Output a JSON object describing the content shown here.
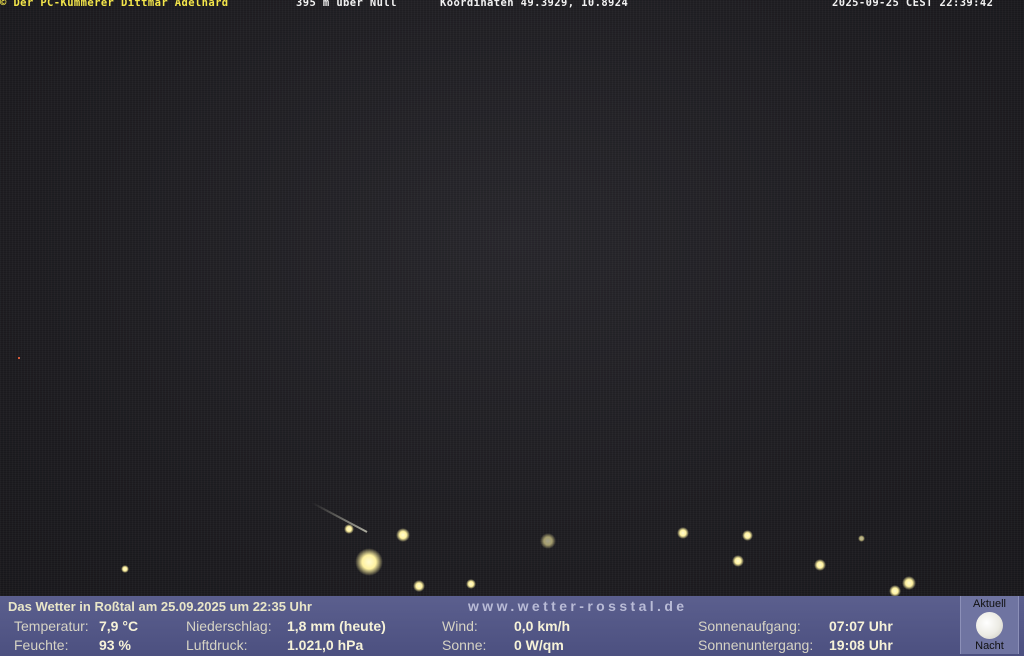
{
  "overlay": {
    "copyright": "© Der PC-Kümmerer Dittmar Adelhard",
    "altitude": "395 m über Null",
    "coordinates": "Koordinaten 49.3929, 10.8924",
    "timestamp": "2025-09-25 CEST 22:39:42"
  },
  "weather": {
    "title": "Das Wetter in Roßtal am 25.09.2025 um 22:35 Uhr",
    "website": "www.wetter-rosstal.de",
    "temperature": {
      "label": "Temperatur:",
      "value": "7,9 °C"
    },
    "humidity": {
      "label": "Feuchte:",
      "value": "93 %"
    },
    "precipitation": {
      "label": "Niederschlag:",
      "value": "1,8 mm (heute)"
    },
    "pressure": {
      "label": "Luftdruck:",
      "value": "1.021,0 hPa"
    },
    "wind": {
      "label": "Wind:",
      "value": "0,0 km/h"
    },
    "sun": {
      "label": "Sonne:",
      "value": "0 W/qm"
    },
    "sunrise": {
      "label": "Sonnenaufgang:",
      "value": "07:07 Uhr"
    },
    "sunset": {
      "label": "Sonnenuntergang:",
      "value": "19:08 Uhr"
    },
    "moon_status_top": "Aktuell",
    "moon_status_bottom": "Nacht"
  }
}
